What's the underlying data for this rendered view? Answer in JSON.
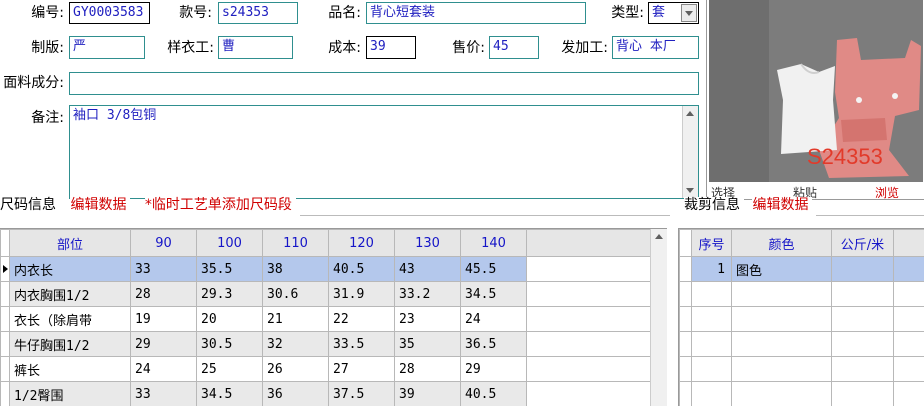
{
  "form": {
    "code_label": "编号:",
    "code_value": "GY0003583",
    "style_label": "款号:",
    "style_value": "s24353",
    "name_label": "品名:",
    "name_value": "背心短套装",
    "type_label": "类型:",
    "type_value": "套",
    "pattern_label": "制版:",
    "pattern_value": "严",
    "sample_label": "样衣工:",
    "sample_value": "曹",
    "cost_label": "成本:",
    "cost_value": "39",
    "price_label": "售价:",
    "price_value": "45",
    "factory_label": "发加工:",
    "factory_value": "背心 本厂",
    "fabric_label": "面料成分:",
    "fabric_value": "",
    "remark_label": "备注:",
    "remark_value": "袖口 3/8包铜"
  },
  "image_panel": {
    "watermark": "S24353",
    "select_label": "选择",
    "paste_label": "粘贴",
    "browse_label": "浏览"
  },
  "size_section": {
    "title": "尺码信息",
    "edit_link": "编辑数据",
    "note": "*临时工艺单添加尺码段",
    "columns": [
      "部位",
      "90",
      "100",
      "110",
      "120",
      "130",
      "140"
    ],
    "rows": [
      [
        "内衣长",
        "33",
        "35.5",
        "38",
        "40.5",
        "43",
        "45.5"
      ],
      [
        "内衣胸围1/2",
        "28",
        "29.3",
        "30.6",
        "31.9",
        "33.2",
        "34.5"
      ],
      [
        "衣长（除肩带",
        "19",
        "20",
        "21",
        "22",
        "23",
        "24"
      ],
      [
        "牛仔胸围1/2",
        "29",
        "30.5",
        "32",
        "33.5",
        "35",
        "36.5"
      ],
      [
        "裤长",
        "24",
        "25",
        "26",
        "27",
        "28",
        "29"
      ],
      [
        "1/2臀围",
        "33",
        "34.5",
        "36",
        "37.5",
        "39",
        "40.5"
      ]
    ]
  },
  "cut_section": {
    "title": "裁剪信息",
    "edit_link": "编辑数据",
    "columns": [
      "序号",
      "颜色",
      "公斤/米"
    ],
    "rows": [
      [
        "1",
        "图色",
        ""
      ]
    ]
  },
  "colors": {
    "accent_red": "#d00000",
    "link_blue": "#1515c8",
    "selected_row": "#b4c8ec"
  }
}
